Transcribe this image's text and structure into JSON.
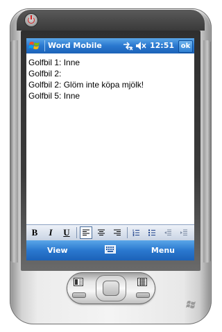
{
  "titlebar": {
    "app_title": "Word Mobile",
    "clock": "12:51",
    "ok_label": "ok",
    "start_icon": "windows-flag-icon",
    "connectivity_icon": "connectivity-icon",
    "volume_icon": "speaker-muted-icon"
  },
  "document": {
    "lines": [
      "Golfbil 1: Inne",
      "Golfbil 2:",
      "Golfbil 2: Glöm inte köpa mjölk!",
      "Golfbil 5: Inne"
    ]
  },
  "format_toolbar": {
    "bold_label": "B",
    "italic_label": "I",
    "underline_label": "U",
    "align_active": "align-left",
    "buttons": [
      "bold",
      "italic",
      "underline",
      "align-left",
      "align-center",
      "align-right",
      "numbered-list",
      "bulleted-list",
      "outdent",
      "indent"
    ]
  },
  "softkeys": {
    "left_label": "View",
    "right_label": "Menu",
    "center_icon": "keyboard-icon"
  },
  "colors": {
    "titlebar_blue": "#2a78cf",
    "toolbar_bg": "#c9d4e4",
    "power_red": "#d61f1f"
  }
}
